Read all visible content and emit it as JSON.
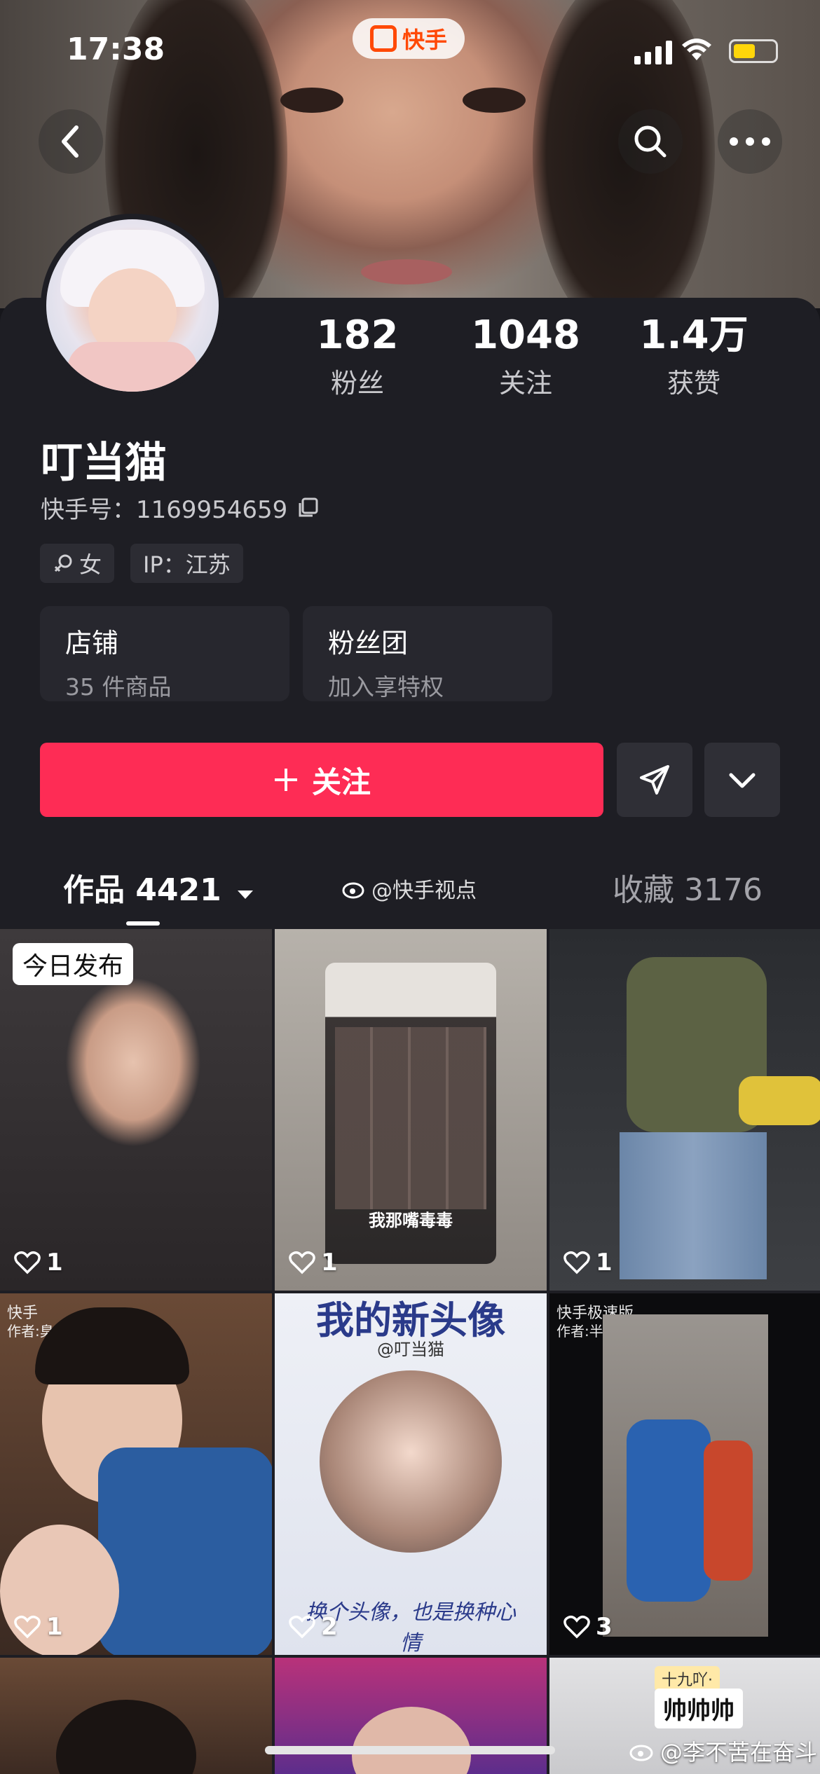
{
  "status_bar": {
    "time": "17:38",
    "app_pill": "快手"
  },
  "profile": {
    "name": "叮当猫",
    "ks_id_label": "快手号：",
    "ks_id": "1169954659",
    "stats": [
      {
        "value": "182",
        "label": "粉丝"
      },
      {
        "value": "1048",
        "label": "关注"
      },
      {
        "value": "1.4万",
        "label": "获赞"
      }
    ],
    "tags": {
      "gender": "女",
      "ip": "IP：江苏"
    },
    "cards": [
      {
        "title": "店铺",
        "subtitle": "35 件商品"
      },
      {
        "title": "粉丝团",
        "subtitle": "加入享特权"
      }
    ],
    "follow_label": "关注"
  },
  "tabs": {
    "works": "作品 4421",
    "watermark": "@快手视点",
    "favorites": "收藏 3176"
  },
  "grid": {
    "items": [
      {
        "likes": "1",
        "badge": "今日发布"
      },
      {
        "likes": "1",
        "caption": "我那嘴毒毒"
      },
      {
        "likes": "1"
      },
      {
        "likes": "1",
        "brand": "快手",
        "author": "作者:臭啊的朋友圈"
      },
      {
        "likes": "2",
        "title": "我的新头像",
        "handle": "@叮当猫",
        "script": "换个头像，也是换种心情"
      },
      {
        "likes": "3",
        "brand": "快手极速版",
        "author": "作者:半颗星星✨"
      },
      {
        "likes": ""
      },
      {
        "likes": ""
      },
      {
        "likes": "",
        "sticker_top": "十九吖·",
        "sticker": "帅帅帅"
      }
    ]
  },
  "weibo_watermark": "@李不苦在奋斗",
  "colors": {
    "accent": "#fe2c55",
    "panel": "#1e1e24",
    "kuaishou_orange": "#ff4906"
  }
}
